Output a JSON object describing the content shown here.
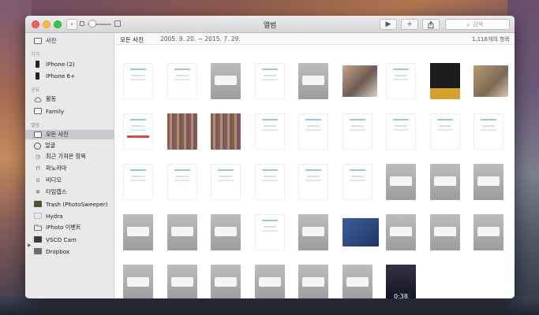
{
  "window": {
    "title": "앨범",
    "search_placeholder": "검색"
  },
  "sidebar": {
    "top_item": "사진",
    "devices_header": "기기",
    "devices": [
      "iPhone (2)",
      "iPhone 6+"
    ],
    "shared_header": "공유",
    "shared": [
      "활동",
      "Family"
    ],
    "albums_header": "앨범",
    "albums": [
      "모든 사진",
      "얼굴",
      "최근 가져온 항목",
      "파노라마",
      "비디오",
      "타임랩스",
      "Trash (PhotoSweeper)",
      "Hydra",
      "iPhoto 이벤트",
      "VSCO Cam",
      "Dropbox"
    ],
    "selected_album": "모든 사진"
  },
  "content": {
    "title": "모든 사진",
    "date_range": "2005. 9. 20. ~ 2015. 7. 29.",
    "count": "1,116개의 항목",
    "thumbnails": [
      [
        "white",
        "white",
        "gray",
        "white",
        "gray",
        "laptop",
        "white",
        "dark",
        "photo"
      ],
      [
        "red",
        "mosaic",
        "mosaic",
        "white",
        "white",
        "white",
        "white",
        "white",
        "white"
      ],
      [
        "white",
        "white",
        "white",
        "white",
        "white",
        "white",
        "gray",
        "gray",
        "gray"
      ],
      [
        "gray",
        "gray",
        "gray",
        "white",
        "gray",
        "desktop",
        "gray",
        "gray",
        "gray"
      ],
      [
        "gray",
        "gray",
        "gray",
        "gray",
        "gray",
        "gray",
        "lock"
      ]
    ],
    "lockscreen_time": "0:38"
  },
  "colors": {
    "selected_row": "#c9c9cd",
    "sidebar_bg": "#e9e9ec",
    "close": "#fc605c",
    "minimize": "#fdbc40",
    "maximize": "#34c84a"
  },
  "icons": [
    "back-arrow-icon",
    "zoom-small-icon",
    "zoom-large-icon",
    "play-icon",
    "plus-icon",
    "share-icon",
    "search-icon"
  ]
}
